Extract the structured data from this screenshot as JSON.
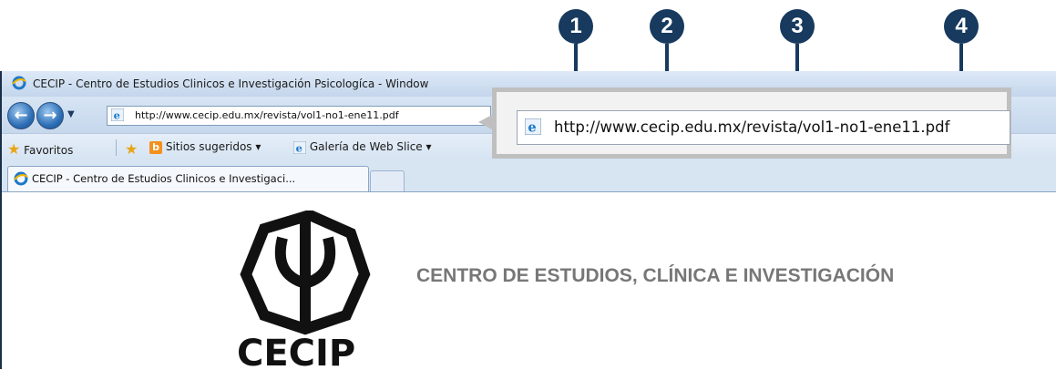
{
  "window": {
    "title": "CECIP - Centro de Estudios Clinicos e Investigación Psicologíca - Window",
    "minimize_glyph": "_"
  },
  "nav": {
    "url": "http://www.cecip.edu.mx/revista/vol1-no1-ene11.pdf"
  },
  "favorites_bar": {
    "favorites_label": "Favoritos",
    "suggested_sites_label": "Sitios sugeridos",
    "web_slice_gallery_label": "Galería de Web Slice"
  },
  "tab": {
    "label": "CECIP - Centro de Estudios Clinicos e Investigaci..."
  },
  "page": {
    "heading": "CENTRO DE ESTUDIOS, CLÍNICA E INVESTIGACIÓN",
    "logo_text": "CECIP"
  },
  "callout": {
    "url": "http://www.cecip.edu.mx/revista/vol1-no1-ene11.pdf",
    "markers": [
      "1",
      "2",
      "3",
      "4"
    ]
  },
  "colors": {
    "badge": "#173a5e",
    "callout_border": "#bfbfbf",
    "heading": "#777777"
  },
  "icons": [
    "ie-icon",
    "back-arrow-icon",
    "forward-arrow-icon",
    "star-icon",
    "add-favorite-icon",
    "bing-icon",
    "dropdown-icon"
  ]
}
